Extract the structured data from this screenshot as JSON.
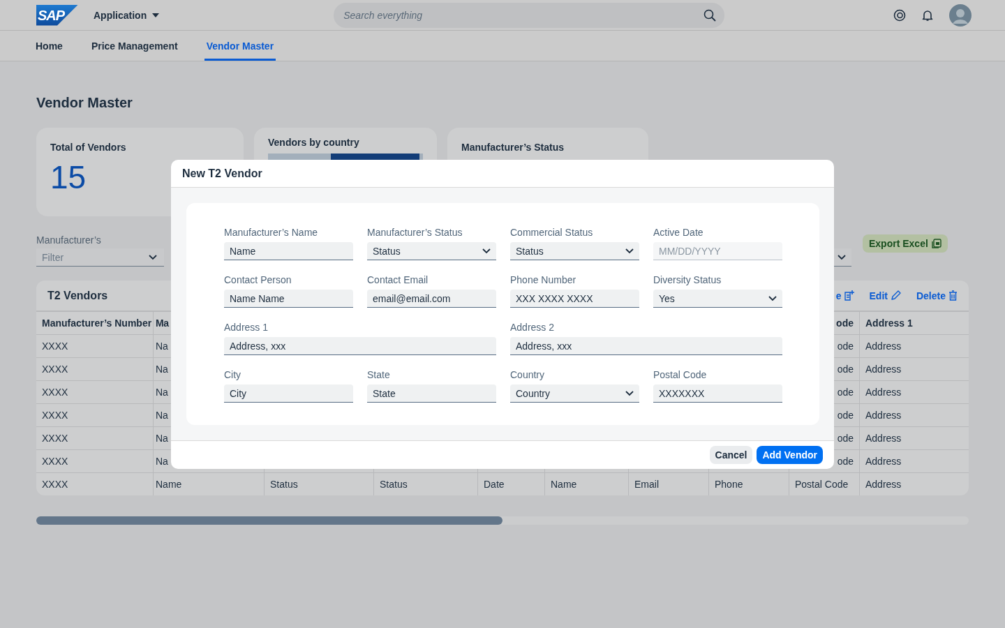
{
  "shell": {
    "logo": "SAP",
    "app_menu": "Application",
    "search": {
      "placeholder": "Search everything"
    }
  },
  "tabs": [
    {
      "label": "Home",
      "selected": false
    },
    {
      "label": "Price Management",
      "selected": false
    },
    {
      "label": "Vendor Master",
      "selected": true
    }
  ],
  "page_title": "Vendor Master",
  "cards": [
    {
      "kind": "kpi",
      "title": "Total of Vendors",
      "value": "15"
    },
    {
      "kind": "chart",
      "title": "Vendors by country"
    },
    {
      "kind": "plain",
      "title": "Manufacturer’s Status"
    }
  ],
  "filter": {
    "label": "Manufacturer’s",
    "placeholder": "Filter"
  },
  "export_button": "Export Excel",
  "table": {
    "title": "T2 Vendors",
    "actions": [
      {
        "kind": "create",
        "label": "e"
      },
      {
        "kind": "edit",
        "label": "Edit"
      },
      {
        "kind": "delete",
        "label": "Delete"
      }
    ],
    "columns": [
      "Manufacturer’s Number",
      "Ma",
      "ode",
      "Address 1"
    ],
    "rows": [
      {
        "cells": [
          "XXXX",
          "Na",
          "ode",
          "Address"
        ]
      },
      {
        "cells": [
          "XXXX",
          "Na",
          "ode",
          "Address"
        ]
      },
      {
        "cells": [
          "XXXX",
          "Na",
          "ode",
          "Address"
        ]
      },
      {
        "cells": [
          "XXXX",
          "Na",
          "ode",
          "Address"
        ]
      },
      {
        "cells": [
          "XXXX",
          "Na",
          "ode",
          "Address"
        ]
      },
      {
        "cells": [
          "XXXX",
          "Na",
          "ode",
          "Address"
        ]
      },
      {
        "cells": [
          "XXXX",
          "Name",
          "Status",
          "Status",
          "Date",
          "Name",
          "Email",
          "Phone",
          "Postal Code",
          "Address"
        ]
      }
    ]
  },
  "dialog": {
    "title": "New T2 Vendor",
    "fields": [
      {
        "kind": "text",
        "label": "Manufacturer’s Name",
        "value": "Name",
        "wide": false
      },
      {
        "kind": "select",
        "label": "Manufacturer’s Status",
        "value": "Status",
        "wide": false
      },
      {
        "kind": "select",
        "label": "Commercial Status",
        "value": "Status",
        "wide": false
      },
      {
        "kind": "date",
        "label": "Active Date",
        "placeholder": "MM/DD/YYYY",
        "wide": false
      },
      {
        "kind": "text",
        "label": "Contact Person",
        "value": "Name Name",
        "wide": false
      },
      {
        "kind": "text",
        "label": "Contact Email",
        "value": "email@email.com",
        "wide": false
      },
      {
        "kind": "text",
        "label": "Phone Number",
        "value": "XXX XXXX XXXX",
        "wide": false
      },
      {
        "kind": "select",
        "label": "Diversity Status",
        "value": "Yes",
        "wide": false
      },
      {
        "kind": "text",
        "label": "Address 1",
        "value": "Address, xxx",
        "wide": true
      },
      {
        "kind": "text",
        "label": "Address 2",
        "value": "Address, xxx",
        "wide": true
      },
      {
        "kind": "text",
        "label": "City",
        "value": "City",
        "wide": false
      },
      {
        "kind": "text",
        "label": "State",
        "value": "State",
        "wide": false
      },
      {
        "kind": "select",
        "label": "Country",
        "value": "Country",
        "wide": false
      },
      {
        "kind": "text",
        "label": "Postal Code",
        "value": "XXXXXXX",
        "wide": false
      }
    ],
    "buttons": [
      {
        "kind": "secondary",
        "label": "Cancel"
      },
      {
        "kind": "primary",
        "label": "Add Vendor"
      }
    ]
  }
}
